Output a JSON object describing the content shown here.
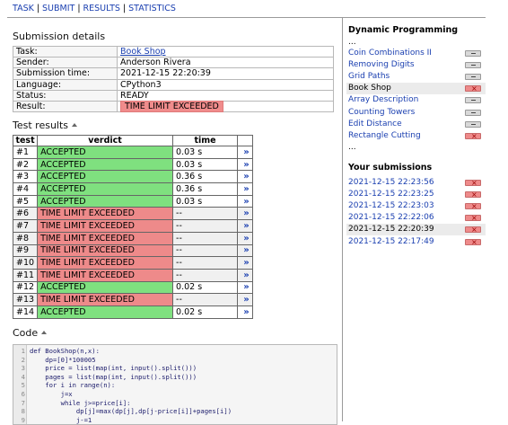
{
  "nav": {
    "task": "TASK",
    "submit": "SUBMIT",
    "results": "RESULTS",
    "statistics": "STATISTICS",
    "sep": "|"
  },
  "details": {
    "heading": "Submission details",
    "rows": [
      {
        "k": "Task:",
        "v": "Book Shop"
      },
      {
        "k": "Sender:",
        "v": "Anderson Rivera"
      },
      {
        "k": "Submission time:",
        "v": "2021-12-15 22:20:39"
      },
      {
        "k": "Language:",
        "v": "CPython3"
      },
      {
        "k": "Status:",
        "v": "READY"
      },
      {
        "k": "Result:",
        "v": "TIME LIMIT EXCEEDED"
      }
    ]
  },
  "tests": {
    "heading": "Test results",
    "headers": [
      "test",
      "verdict",
      "time"
    ],
    "go_icon": "»",
    "rows": [
      {
        "id": "#1",
        "verdict": "ACCEPTED",
        "time": "0.03 s"
      },
      {
        "id": "#2",
        "verdict": "ACCEPTED",
        "time": "0.03 s"
      },
      {
        "id": "#3",
        "verdict": "ACCEPTED",
        "time": "0.36 s"
      },
      {
        "id": "#4",
        "verdict": "ACCEPTED",
        "time": "0.36 s"
      },
      {
        "id": "#5",
        "verdict": "ACCEPTED",
        "time": "0.03 s"
      },
      {
        "id": "#6",
        "verdict": "TIME LIMIT EXCEEDED",
        "time": "--"
      },
      {
        "id": "#7",
        "verdict": "TIME LIMIT EXCEEDED",
        "time": "--"
      },
      {
        "id": "#8",
        "verdict": "TIME LIMIT EXCEEDED",
        "time": "--"
      },
      {
        "id": "#9",
        "verdict": "TIME LIMIT EXCEEDED",
        "time": "--"
      },
      {
        "id": "#10",
        "verdict": "TIME LIMIT EXCEEDED",
        "time": "--"
      },
      {
        "id": "#11",
        "verdict": "TIME LIMIT EXCEEDED",
        "time": "--"
      },
      {
        "id": "#12",
        "verdict": "ACCEPTED",
        "time": "0.02 s"
      },
      {
        "id": "#13",
        "verdict": "TIME LIMIT EXCEEDED",
        "time": "--"
      },
      {
        "id": "#14",
        "verdict": "ACCEPTED",
        "time": "0.02 s"
      }
    ]
  },
  "code": {
    "heading": "Code",
    "lines": [
      "def BookShop(n,x):",
      "    dp=[0]*100005",
      "    price = list(map(int, input().split()))",
      "    pages = list(map(int, input().split()))",
      "    for i in range(n):",
      "        j=x",
      "        while j>=price[i]:",
      "            dp[j]=max(dp[j],dp[j-price[i]]+pages[i])",
      "            j-=1"
    ]
  },
  "sidebar": {
    "section_title": "Dynamic Programming",
    "ellipsis": "...",
    "tasks": [
      {
        "label": "Coin Combinations II",
        "status": "none"
      },
      {
        "label": "Removing Digits",
        "status": "none"
      },
      {
        "label": "Grid Paths",
        "status": "none"
      },
      {
        "label": "Book Shop",
        "status": "fail",
        "current": true
      },
      {
        "label": "Array Description",
        "status": "none"
      },
      {
        "label": "Counting Towers",
        "status": "none"
      },
      {
        "label": "Edit Distance",
        "status": "none"
      },
      {
        "label": "Rectangle Cutting",
        "status": "fail"
      }
    ],
    "submissions_title": "Your submissions",
    "submissions": [
      {
        "time": "2021-12-15 22:23:56"
      },
      {
        "time": "2021-12-15 22:23:25"
      },
      {
        "time": "2021-12-15 22:23:03"
      },
      {
        "time": "2021-12-15 22:22:06"
      },
      {
        "time": "2021-12-15 22:20:39",
        "current": true
      },
      {
        "time": "2021-12-15 22:17:49"
      }
    ]
  },
  "colors": {
    "link": "#1a3fb0",
    "accepted": "#7fe07f",
    "failed": "#ee8a8a"
  }
}
